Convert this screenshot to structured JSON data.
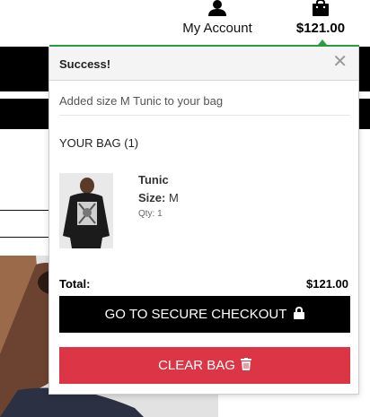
{
  "header": {
    "account_label": "My Account",
    "account_icon": "user-icon",
    "bag_total": "$121.00",
    "bag_icon": "shopping-bag-icon"
  },
  "popover": {
    "title": "Success!",
    "close_glyph": "✕",
    "message": "Added size M Tunic to your bag",
    "bag_heading": "YOUR BAG (1)",
    "item": {
      "name": "Tunic",
      "size_label": "Size:",
      "size_value": "M",
      "qty": "Qty: 1"
    },
    "total_label": "Total:",
    "total_value": "$121.00",
    "checkout_label": "GO TO SECURE CHECKOUT",
    "checkout_icon": "lock-icon",
    "clear_label": "CLEAR BAG",
    "clear_icon": "trash-icon"
  },
  "colors": {
    "success_accent": "#2e9e45",
    "checkout_bg": "#000000",
    "clear_bg": "#dc3545"
  }
}
